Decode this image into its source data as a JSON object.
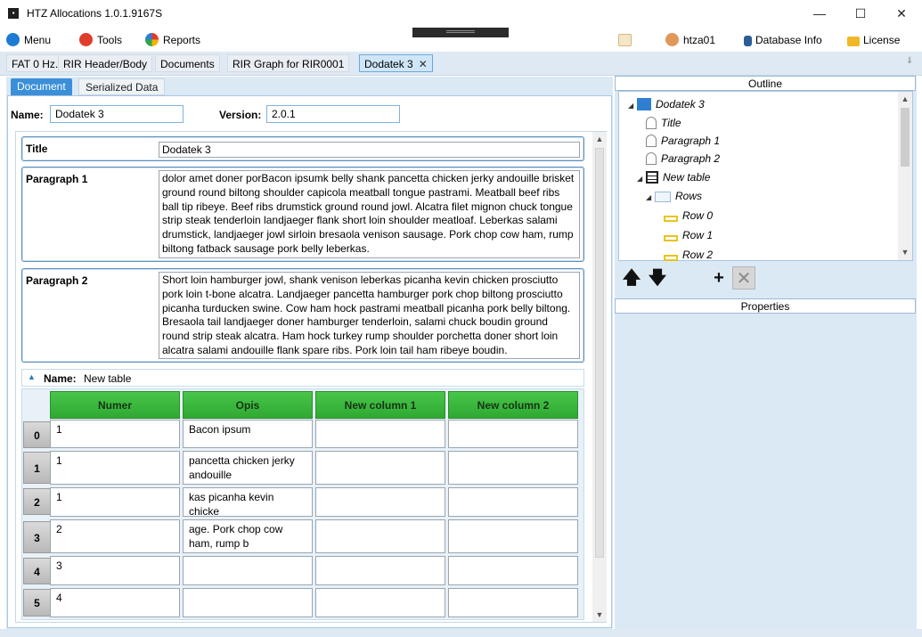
{
  "window": {
    "title": "HTZ Allocations 1.0.1.9167S",
    "minimize": "—",
    "maximize": "☐",
    "close": "✕"
  },
  "menubar": {
    "menu": "Menu",
    "tools": "Tools",
    "reports": "Reports",
    "user": "htza01",
    "database_info": "Database Info",
    "license": "License"
  },
  "doc_tabs": [
    {
      "label": "FAT 0 Hz."
    },
    {
      "label": "RIR Header/Body"
    },
    {
      "label": "Documents"
    },
    {
      "label": "RIR Graph for RIR0001"
    },
    {
      "label": "Dodatek 3"
    }
  ],
  "sub_tabs": {
    "document": "Document",
    "serialized": "Serialized Data"
  },
  "doc": {
    "name_label": "Name:",
    "name_value": "Dodatek 3",
    "version_label": "Version:",
    "version_value": "2.0.1",
    "title_label": "Title",
    "title_value": "Dodatek 3",
    "p1_label": "Paragraph 1",
    "p1_value": " dolor amet doner porBacon ipsumk belly shank pancetta chicken jerky andouille brisket ground round biltong shoulder capicola meatball tongue pastrami. Meatball beef ribs ball tip ribeye. Beef ribs drumstick ground round jowl. Alcatra filet mignon chuck tongue strip steak tenderloin landjaeger flank short loin shoulder meatloaf. Leberkas salami drumstick, landjaeger jowl sirloin bresaola venison sausage. Pork chop cow ham, rump biltong fatback sausage pork belly leberkas.",
    "p2_label": "Paragraph 2",
    "p2_value": "Short loin hamburger jowl, shank venison leberkas picanha kevin chicken prosciutto pork loin t-bone alcatra. Landjaeger pancetta hamburger pork chop biltong prosciutto picanha turducken swine. Cow ham hock pastrami meatball picanha pork belly biltong. Bresaola tail landjaeger doner hamburger tenderloin, salami chuck boudin ground round strip steak alcatra. Ham hock turkey rump shoulder porchetta doner short loin alcatra salami andouille flank spare ribs. Pork loin tail ham ribeye boudin.",
    "table_name_label": "Name:",
    "table_name_value": "New table"
  },
  "table": {
    "columns": [
      "Numer",
      "Opis",
      "New column 1",
      "New column 2"
    ],
    "rows": [
      {
        "idx": "0",
        "numer": "1",
        "opis": "Bacon ipsum",
        "c1": "",
        "c2": ""
      },
      {
        "idx": "1",
        "numer": "1",
        "opis": "pancetta chicken jerky andouille",
        "c1": "",
        "c2": ""
      },
      {
        "idx": "2",
        "numer": "1",
        "opis": "kas picanha kevin chicke",
        "c1": "",
        "c2": ""
      },
      {
        "idx": "3",
        "numer": "2",
        "opis": "age. Pork chop cow ham, rump b",
        "c1": "",
        "c2": ""
      },
      {
        "idx": "4",
        "numer": "3",
        "opis": "",
        "c1": "",
        "c2": ""
      },
      {
        "idx": "5",
        "numer": "4",
        "opis": "",
        "c1": "",
        "c2": ""
      }
    ]
  },
  "outline": {
    "header": "Outline",
    "items": [
      "Dodatek 3",
      "Title",
      "Paragraph 1",
      "Paragraph 2",
      "New table",
      "Rows",
      "Row 0",
      "Row 1",
      "Row 2"
    ]
  },
  "properties": {
    "header": "Properties"
  },
  "colors": {
    "accent": "#3b8fd9",
    "grid_header": "#3db83f",
    "panel_bg": "#dbe9f5"
  }
}
